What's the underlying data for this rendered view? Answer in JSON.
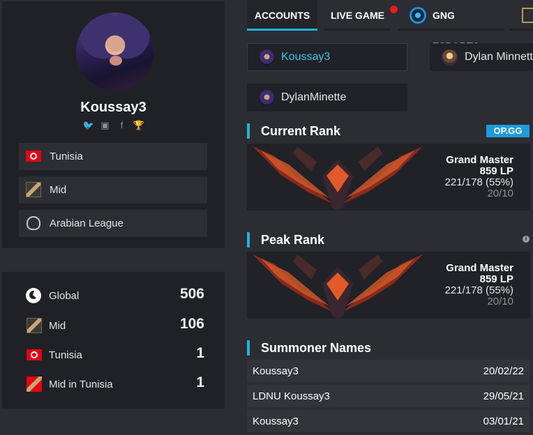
{
  "profile": {
    "username": "Koussay3",
    "social_icons": [
      "twitter-icon",
      "twitch-icon",
      "facebook-icon",
      "trophy-icon"
    ],
    "info": [
      {
        "icon": "tunisia-flag-icon",
        "label": "Tunisia"
      },
      {
        "icon": "mid-role-icon",
        "label": "Mid"
      },
      {
        "icon": "arabian-league-icon",
        "label": "Arabian League"
      }
    ]
  },
  "rankings": [
    {
      "icon": "globe-icon",
      "label": "Global",
      "value": "506"
    },
    {
      "icon": "mid-role-icon",
      "label": "Mid",
      "value": "106"
    },
    {
      "icon": "tunisia-flag-icon",
      "label": "Tunisia",
      "value": "1"
    },
    {
      "icon": "mid-tunisia-icon",
      "label": "Mid in Tunisia",
      "value": "1"
    }
  ],
  "tabs": [
    {
      "label": "ACCOUNTS",
      "active": true
    },
    {
      "label": "LIVE GAME",
      "live_indicator": true
    },
    {
      "label": "GNG ESPORTS"
    }
  ],
  "accounts": [
    {
      "name": "Koussay3",
      "selected": true
    },
    {
      "name": "Dylan Minnett"
    },
    {
      "name": "DylanMinette"
    }
  ],
  "current_rank": {
    "title": "Current Rank",
    "source": "OP.GG",
    "tier": "Grand Master",
    "lp": "859 LP",
    "record": "221/178 (55%)",
    "season": "20/10"
  },
  "peak_rank": {
    "title": "Peak Rank",
    "info": "i",
    "tier": "Grand Master",
    "lp": "859 LP",
    "record": "221/178 (55%)",
    "season": "20/10"
  },
  "summoner_names": {
    "title": "Summoner Names",
    "rows": [
      {
        "name": "Koussay3",
        "date": "20/02/22"
      },
      {
        "name": "LDNU Koussay3",
        "date": "29/05/21"
      },
      {
        "name": "Koussay3",
        "date": "03/01/21"
      }
    ]
  },
  "colors": {
    "accent": "#1fb3d8",
    "selected_text": "#3cc3e8",
    "live_dot": "#e3201c",
    "opgg": "#1e9bdb"
  }
}
